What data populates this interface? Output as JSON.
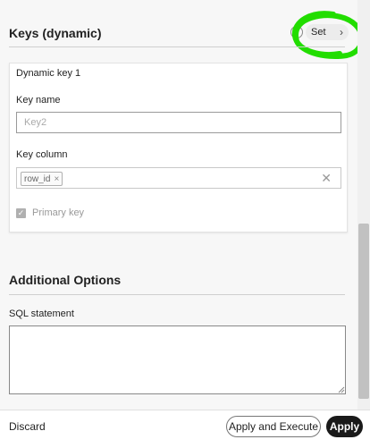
{
  "keys_section": {
    "title": "Keys (dynamic)",
    "help_icon_glyph": "?",
    "set_button_label": "Set",
    "set_chevron": "›",
    "highlight_color": "#22dd00"
  },
  "dynamic_key": {
    "title": "Dynamic key 1",
    "key_name_label": "Key name",
    "key_name_placeholder": "Key2",
    "key_column_label": "Key column",
    "key_column_chips": [
      {
        "label": "row_id",
        "remove_glyph": "×"
      }
    ],
    "clear_glyph": "✕",
    "primary_key_label": "Primary key",
    "primary_key_checked": true,
    "checkmark_glyph": "✓"
  },
  "additional_options": {
    "title": "Additional Options",
    "sql_label": "SQL statement",
    "sql_value": ""
  },
  "footer": {
    "discard_label": "Discard",
    "apply_execute_label": "Apply and Execute",
    "apply_label": "Apply"
  }
}
